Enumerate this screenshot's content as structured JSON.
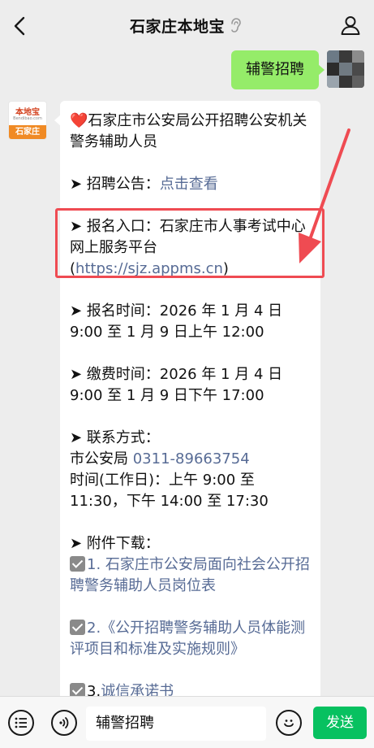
{
  "header": {
    "title": "石家庄本地宝",
    "back_icon": "chevron-left-icon",
    "listen_icon": "ear-icon",
    "user_icon": "person-icon"
  },
  "sent_message": {
    "text": "辅警招聘"
  },
  "account_avatar": {
    "brand": "本地宝",
    "domain": "Bendibao.com",
    "city": "石家庄"
  },
  "reply": {
    "heading": "石家庄市公安局公开招聘公安机关警务辅助人员",
    "announcement_label": "➤ 招聘公告：",
    "announcement_link": "点击查看",
    "register_label": "➤ 报名入口：石家庄市人事考试中心网上服务平台(",
    "register_link": "https://sjz.appms.cn",
    "register_close": ")",
    "signup_time": "➤ 报名时间：2026 年 1 月 4 日 9:00 至 1 月 9 日上午 12:00",
    "payment_time": "➤ 缴费时间：2026 年 1 月 4 日 9:00 至 1 月 9 日下午 17:00",
    "contact_label": "➤ 联系方式：",
    "contact_org": "市公安局 ",
    "contact_phone": "0311-89663754",
    "contact_hours": "时间(工作日)：上午 9:00 至 11:30，下午 14:00 至 17:30",
    "attach_label": "➤ 附件下载：",
    "attach_1_num": "1. ",
    "attach_1": "石家庄市公安局面向社会公开招聘警务辅助人员岗位表",
    "attach_2_num": "2.",
    "attach_2": "《公开招聘警务辅助人员体能测评项目和标准及实施规则》",
    "attach_3_num": "3.",
    "attach_3": "诚信承诺书"
  },
  "input_bar": {
    "voice_icon": "voice-icon",
    "input_value": "辅警招聘",
    "emoji_icon": "emoji-icon",
    "send_label": "发送",
    "menu_icon": "menu-icon"
  },
  "colors": {
    "link": "#576b95",
    "sent_bubble": "#95ec69",
    "send_button": "#07c160",
    "highlight": "#ef4b52"
  }
}
